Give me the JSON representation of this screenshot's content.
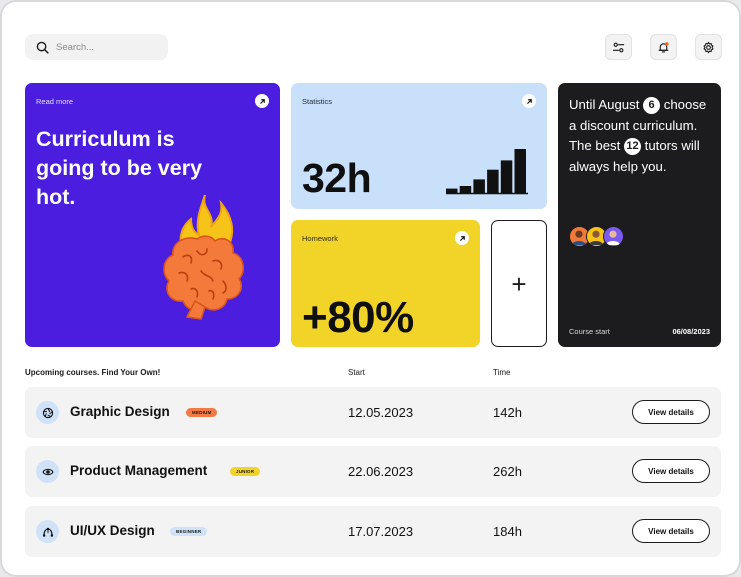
{
  "search": {
    "placeholder": "Search..."
  },
  "toolbar": {
    "icons": [
      "filter-icon",
      "notification-bell-icon",
      "gear-icon"
    ],
    "notification_dot_color": "#f26a2e"
  },
  "cards": {
    "curriculum": {
      "link": "Read more",
      "headline": "Curriculum is going to be very hot.",
      "bg": "#4a1ddf",
      "illustration": "brain-on-fire"
    },
    "statistics": {
      "label": "Statistics",
      "value": "32h",
      "bg": "#c9e0fb",
      "bar_levels": [
        0.1,
        0.16,
        0.31,
        0.53,
        0.74,
        1.0
      ]
    },
    "homework": {
      "label": "Homework",
      "value": "+80%",
      "bg": "#f2d429"
    },
    "add": {
      "symbol": "+"
    },
    "promo": {
      "text_1": "Until August",
      "num_1": "6",
      "text_2": "choose a discount curriculum. The best",
      "num_2": "12",
      "text_3": "tutors will always help you.",
      "footer_label": "Course start",
      "footer_date": "06/08/2023",
      "bg": "#1c1c1e"
    }
  },
  "table": {
    "headers": {
      "title": "Upcoming courses. Find Your Own!",
      "start": "Start",
      "time": "Time"
    },
    "rows": [
      {
        "icon": "aperture-icon",
        "name": "Graphic Design",
        "level": "MEDIUM",
        "level_color": "#f47a45",
        "start": "12.05.2023",
        "time": "142h",
        "action": "View details"
      },
      {
        "icon": "eye-icon",
        "name": "Product Management",
        "level": "JUNIOR",
        "level_color": "#f2d429",
        "start": "22.06.2023",
        "time": "262h",
        "action": "View details"
      },
      {
        "icon": "design-tool-icon",
        "name": "UI/UX Design",
        "level": "BEGINNER",
        "level_color": "#cfe2f8",
        "start": "17.07.2023",
        "time": "184h",
        "action": "View details"
      }
    ]
  }
}
